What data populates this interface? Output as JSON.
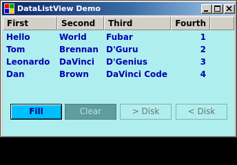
{
  "window": {
    "title": "DataListView Demo",
    "icon": "app-icon",
    "caption_buttons": [
      "minimize-icon",
      "maximize-icon",
      "close-icon"
    ]
  },
  "list": {
    "columns": [
      "First",
      "Second",
      "Third",
      "Fourth"
    ],
    "rows": [
      [
        "Hello",
        "World",
        "Fubar",
        "1"
      ],
      [
        "Tom",
        "Brennan",
        "D'Guru",
        "2"
      ],
      [
        "Leonardo",
        "DaVinci",
        "D'Genius",
        "3"
      ],
      [
        "Dan",
        "Brown",
        "DaVinci Code",
        "4"
      ]
    ]
  },
  "buttons": {
    "fill": "Fill",
    "clear": "Clear",
    "to_disk": "> Disk",
    "from_disk": "< Disk"
  },
  "colors": {
    "background": "#afeeee",
    "text": "#0000b0",
    "fill_button": "#00bfff",
    "clear_button": "#5f9ea0",
    "titlebar_start": "#0a246a",
    "titlebar_end": "#a6caf0"
  }
}
